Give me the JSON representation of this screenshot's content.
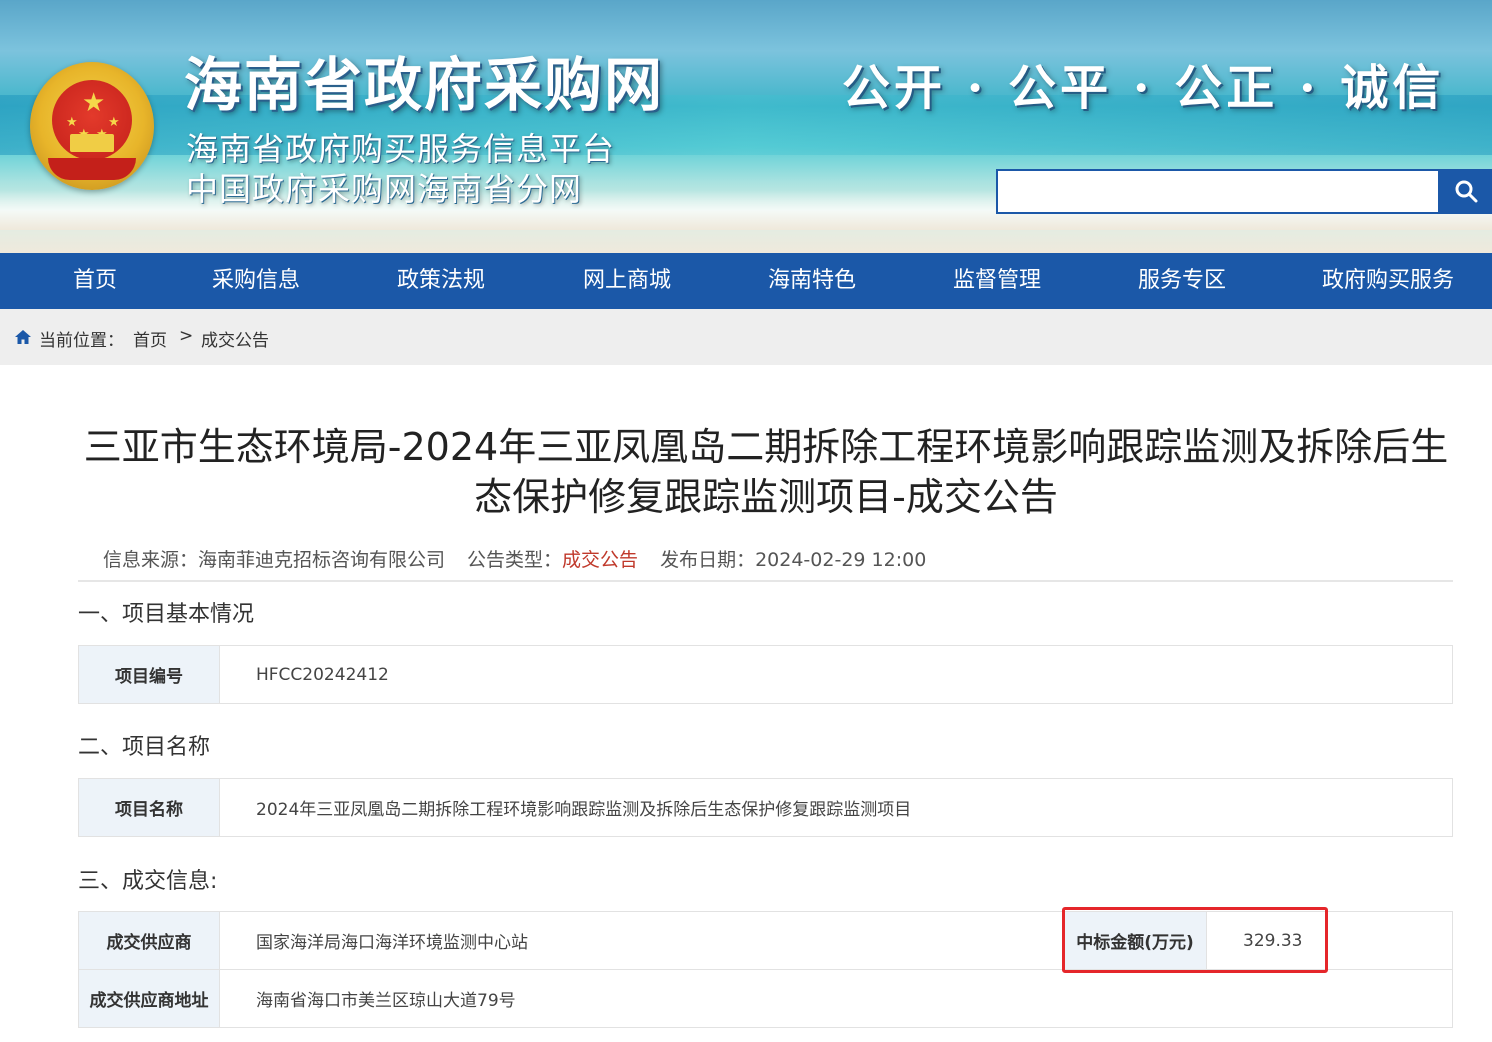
{
  "header": {
    "title": "海南省政府采购网",
    "subtitle_1": "海南省政府购买服务信息平台",
    "subtitle_2": "中国政府采购网海南省分网",
    "slogan": "公开 · 公平 · 公正 · 诚信",
    "search": {
      "value": "",
      "placeholder": ""
    },
    "emblem": "national-emblem"
  },
  "nav": {
    "items": [
      {
        "label": "首页"
      },
      {
        "label": "采购信息"
      },
      {
        "label": "政策法规"
      },
      {
        "label": "网上商城"
      },
      {
        "label": "海南特色"
      },
      {
        "label": "监督管理"
      },
      {
        "label": "服务专区"
      },
      {
        "label": "政府购买服务"
      }
    ]
  },
  "breadcrumb": {
    "icon": "home-icon",
    "prefix": "当前位置：",
    "home": "首页",
    "separator": ">",
    "current": "成交公告"
  },
  "article": {
    "title": "三亚市生态环境局-2024年三亚凤凰岛二期拆除工程环境影响跟踪监测及拆除后生态保护修复跟踪监测项目-成交公告",
    "source_label": "信息来源：",
    "source_value": "海南菲迪克招标咨询有限公司",
    "type_label": "公告类型：",
    "type_value": "成交公告",
    "date_label": "发布日期：",
    "date_value": "2024-02-29 12:00",
    "accent_color": "#c0392b"
  },
  "sections": {
    "basic": {
      "heading": "一、项目基本情况",
      "label": "项目编号",
      "value": "HFCC20242412"
    },
    "name": {
      "heading": "二、项目名称",
      "label": "项目名称",
      "value": "2024年三亚凤凰岛二期拆除工程环境影响跟踪监测及拆除后生态保护修复跟踪监测项目"
    },
    "deal": {
      "heading": "三、成交信息:",
      "supplier_label": "成交供应商",
      "supplier_value": "国家海洋局海口海洋环境监测中心站",
      "amount_label": "中标金额(万元)",
      "amount_value": "329.33",
      "address_label": "成交供应商地址",
      "address_value": "海南省海口市美兰区琼山大道79号"
    }
  },
  "colors": {
    "nav_bg": "#1b58a8",
    "label_bg": "#edf3f9",
    "highlight": "#e5262a"
  }
}
